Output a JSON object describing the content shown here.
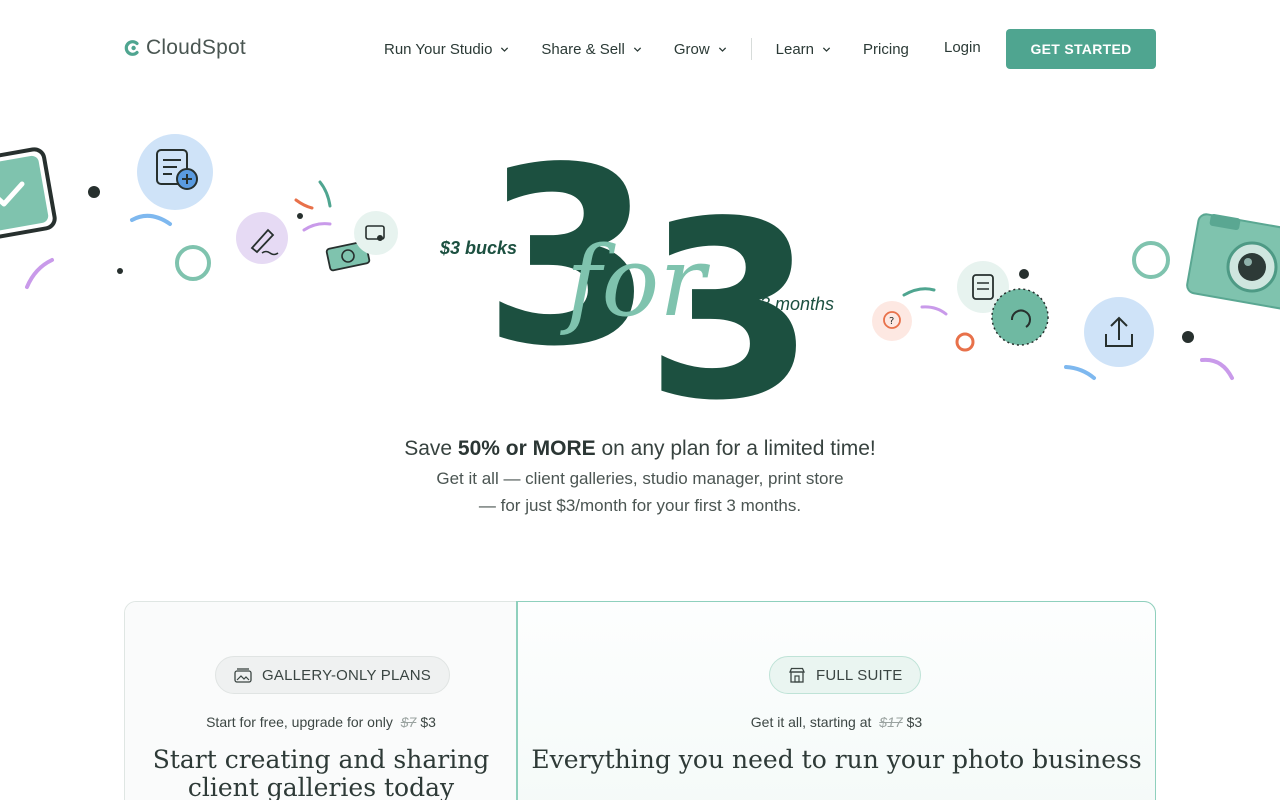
{
  "brand": {
    "name": "CloudSpot",
    "color": "#4fa590"
  },
  "nav": {
    "items": [
      {
        "label": "Run Your Studio",
        "dropdown": true
      },
      {
        "label": "Share & Sell",
        "dropdown": true
      },
      {
        "label": "Grow",
        "dropdown": true
      },
      {
        "label": "Learn",
        "dropdown": true
      },
      {
        "label": "Pricing",
        "dropdown": false
      }
    ],
    "login": "Login",
    "cta": "GET STARTED"
  },
  "hero": {
    "left_tag": "$3 bucks",
    "big_left": "3",
    "script_word": "for",
    "big_right": "3",
    "right_tag": "3 months",
    "headline_pre": "Save ",
    "headline_bold": "50% or MORE",
    "headline_post": " on any plan for a limited time!",
    "sub_line1": "Get it all — client galleries, studio manager, print store",
    "sub_line2": "— for just $3/month for your first 3 months.",
    "colors": {
      "dark": "#1c5040",
      "light": "#7fc3ae"
    },
    "icons": [
      "checkbox-icon",
      "checklist-add-icon",
      "pencil-icon",
      "money-icon",
      "wallet-icon",
      "invoice-icon",
      "refresh-coin-icon",
      "question-bubble-icon",
      "upload-icon",
      "camera-icon"
    ]
  },
  "cards": {
    "left": {
      "pill": "GALLERY-ONLY PLANS",
      "note_pre": "Start for free, upgrade for only",
      "old_price": "$7",
      "new_price": "$3",
      "title_line1": "Start creating and sharing",
      "title_line2": "client galleries today"
    },
    "right": {
      "pill": "FULL SUITE",
      "note_pre": "Get it all, starting at",
      "old_price": "$17",
      "new_price": "$3",
      "title_line1": "Everything you need to run your photo business"
    }
  }
}
